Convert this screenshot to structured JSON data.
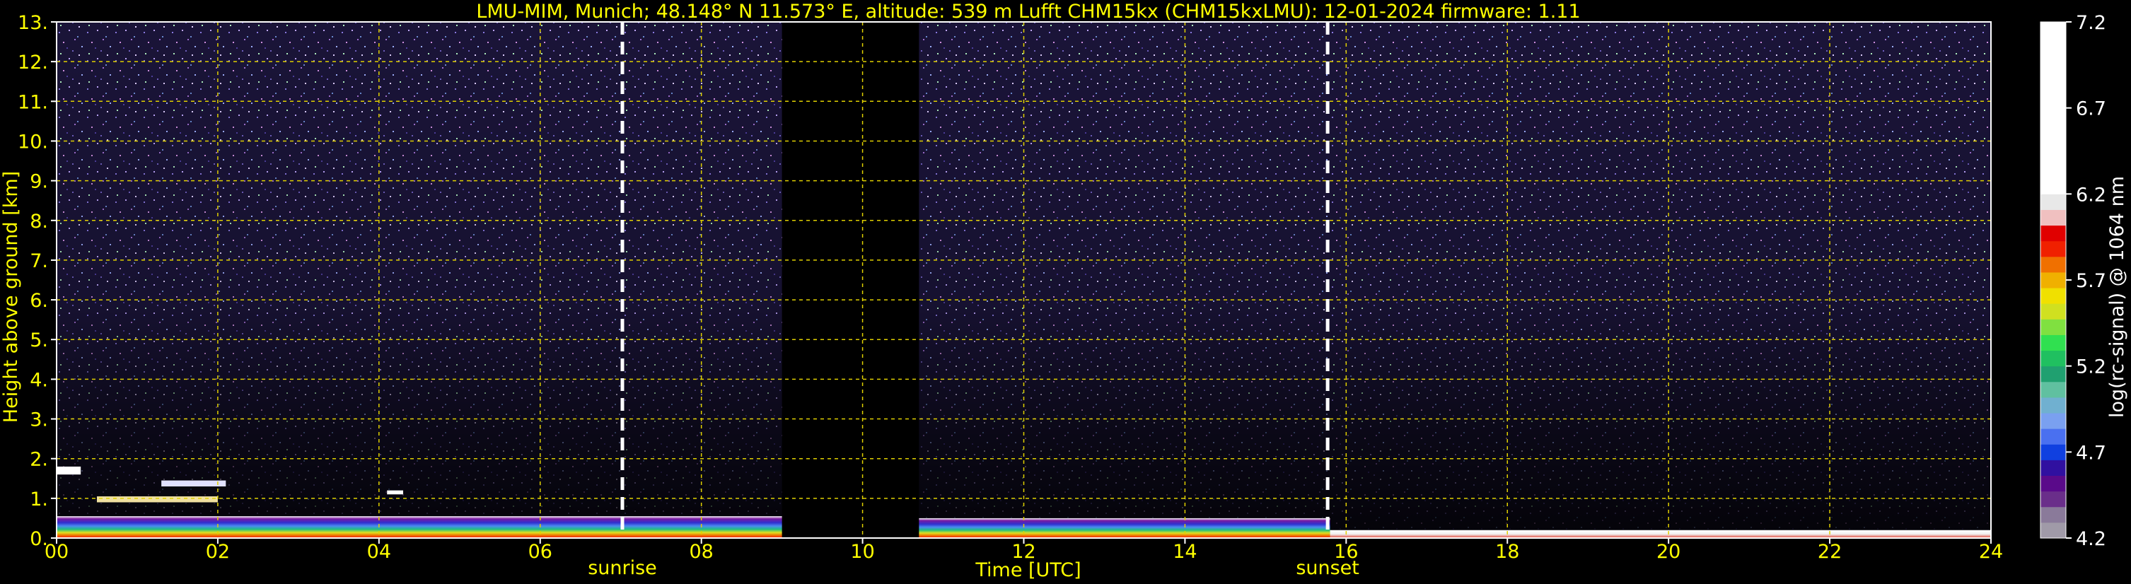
{
  "chart_data": {
    "type": "heatmap",
    "title": "LMU-MIM, Munich; 48.148° N 11.573° E, altitude: 539 m    Lufft CHM15kx (CHM15kxLMU): 12-01-2024    firmware: 1.11",
    "xlabel": "Time [UTC]",
    "ylabel": "Height above ground [km]",
    "xlim": [
      0,
      24
    ],
    "ylim": [
      0,
      13
    ],
    "x_ticks": [
      "00",
      "02",
      "04",
      "06",
      "08",
      "10",
      "12",
      "14",
      "16",
      "18",
      "20",
      "22",
      "24"
    ],
    "y_ticks": [
      "0.",
      "1.",
      "2.",
      "3.",
      "4.",
      "5.",
      "6.",
      "7.",
      "8.",
      "9.",
      "10.",
      "11.",
      "12.",
      "13."
    ],
    "grid": true,
    "colorbar": {
      "label": "log(rc-signal) @ 1064 nm",
      "range": [
        4.2,
        7.2
      ],
      "ticks": [
        "4.2",
        "4.7",
        "5.2",
        "5.7",
        "6.2",
        "6.7",
        "7.2"
      ],
      "colors": [
        "#a09aa8",
        "#8a7a9a",
        "#6a2e8a",
        "#5a0a8a",
        "#3010a0",
        "#1040e0",
        "#4a70f0",
        "#7aa0f0",
        "#70b0d0",
        "#60c0a0",
        "#20a070",
        "#20c060",
        "#30e050",
        "#80e040",
        "#d0e020",
        "#f0e000",
        "#f0b000",
        "#f07000",
        "#f02000",
        "#e00000",
        "#f0c0c0",
        "#e8e8e8",
        "#ffffff"
      ]
    },
    "vertical_markers": [
      {
        "label": "sunrise",
        "x": 7.02
      },
      {
        "label": "sunset",
        "x": 15.77
      }
    ],
    "data_gap": {
      "x_start": 9.0,
      "x_end": 10.7
    },
    "cloud_base_layers": [
      {
        "x_start": 0.0,
        "x_end": 9.0,
        "height_km": 0.5
      },
      {
        "x_start": 10.7,
        "x_end": 15.8,
        "height_km": 0.45
      },
      {
        "x_start": 15.8,
        "x_end": 24.0,
        "height_km": 0.15
      }
    ]
  }
}
